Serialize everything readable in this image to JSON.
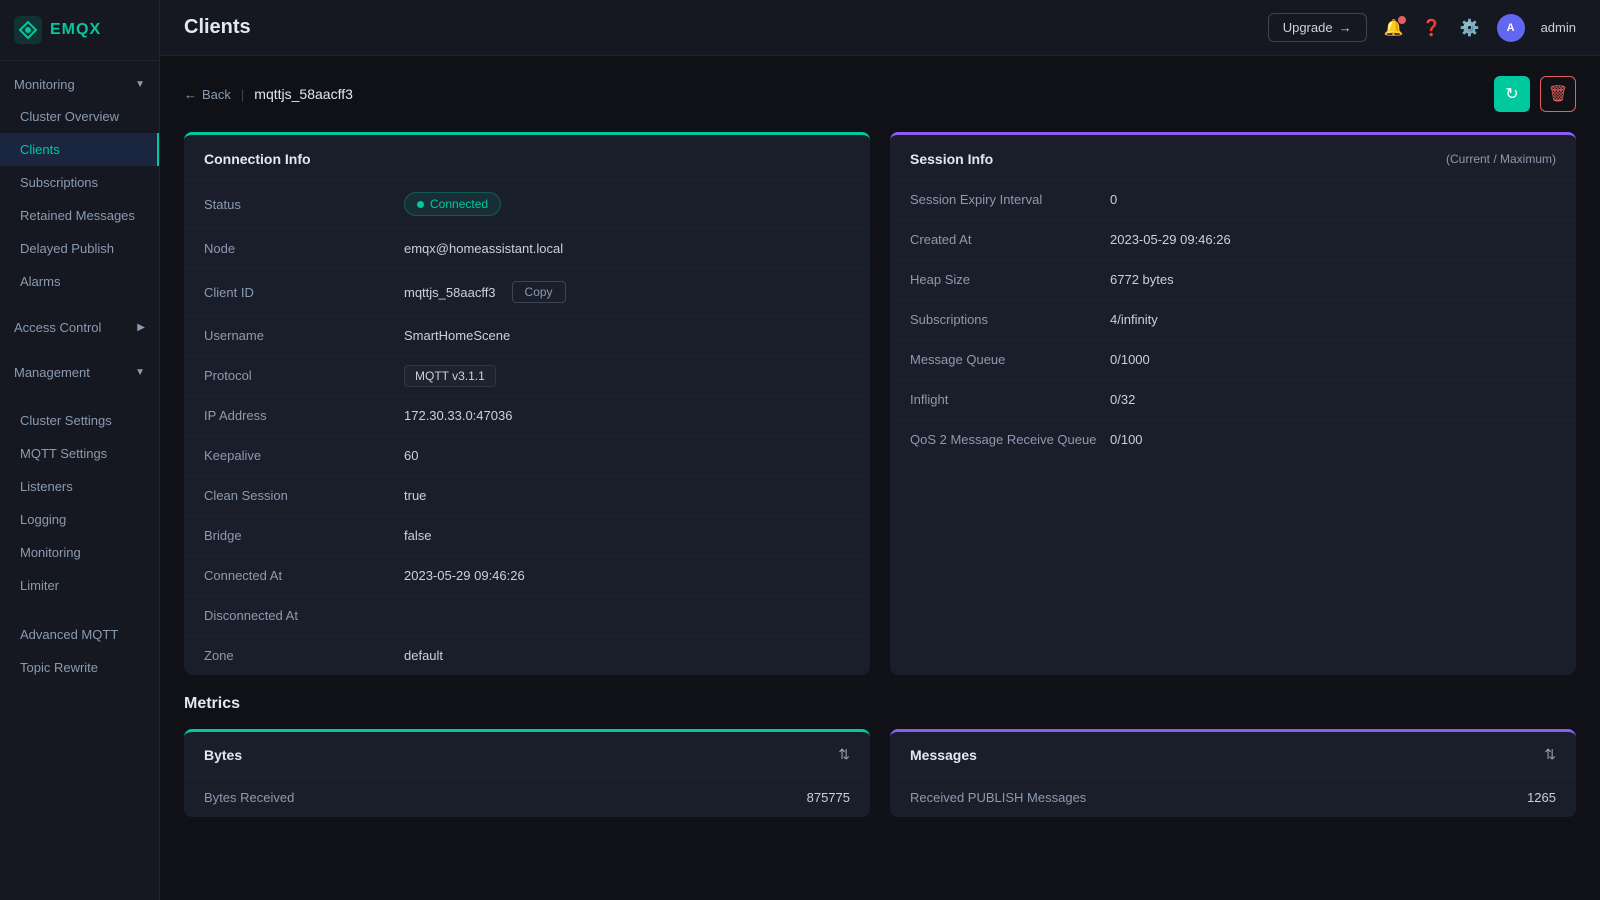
{
  "app": {
    "logo": "EMQX",
    "page_title": "Clients"
  },
  "topbar": {
    "upgrade_label": "Upgrade",
    "admin_label": "admin",
    "avatar_initials": "A"
  },
  "sidebar": {
    "monitoring_label": "Monitoring",
    "cluster_overview_label": "Cluster Overview",
    "clients_label": "Clients",
    "subscriptions_label": "Subscriptions",
    "retained_messages_label": "Retained Messages",
    "delayed_publish_label": "Delayed Publish",
    "alarms_label": "Alarms",
    "access_control_label": "Access Control",
    "management_label": "Management",
    "cluster_settings_label": "Cluster Settings",
    "mqtt_settings_label": "MQTT Settings",
    "listeners_label": "Listeners",
    "logging_label": "Logging",
    "monitoring_sub_label": "Monitoring",
    "limiter_label": "Limiter",
    "advanced_mqtt_label": "Advanced MQTT",
    "topic_rewrite_label": "Topic Rewrite"
  },
  "breadcrumb": {
    "back_label": "Back",
    "client_id": "mqttjs_58aacff3"
  },
  "connection_info": {
    "title": "Connection Info",
    "status_label": "Status",
    "status_value": "Connected",
    "node_label": "Node",
    "node_value": "emqx@homeassistant.local",
    "client_id_label": "Client ID",
    "client_id_value": "mqttjs_58aacff3",
    "copy_label": "Copy",
    "username_label": "Username",
    "username_value": "SmartHomeScene",
    "protocol_label": "Protocol",
    "protocol_value": "MQTT v3.1.1",
    "ip_address_label": "IP Address",
    "ip_address_value": "172.30.33.0:47036",
    "keepalive_label": "Keepalive",
    "keepalive_value": "60",
    "clean_session_label": "Clean Session",
    "clean_session_value": "true",
    "bridge_label": "Bridge",
    "bridge_value": "false",
    "connected_at_label": "Connected At",
    "connected_at_value": "2023-05-29 09:46:26",
    "disconnected_at_label": "Disconnected At",
    "disconnected_at_value": "",
    "zone_label": "Zone",
    "zone_value": "default"
  },
  "session_info": {
    "title": "Session Info",
    "subtitle": "(Current / Maximum)",
    "session_expiry_label": "Session Expiry Interval",
    "session_expiry_value": "0",
    "created_at_label": "Created At",
    "created_at_value": "2023-05-29 09:46:26",
    "heap_size_label": "Heap Size",
    "heap_size_value": "6772 bytes",
    "subscriptions_label": "Subscriptions",
    "subscriptions_value": "4/infinity",
    "message_queue_label": "Message Queue",
    "message_queue_value": "0/1000",
    "inflight_label": "Inflight",
    "inflight_value": "0/32",
    "qos2_label": "QoS 2 Message Receive Queue",
    "qos2_value": "0/100"
  },
  "metrics": {
    "title": "Metrics",
    "bytes_card": {
      "title": "Bytes",
      "bytes_received_label": "Bytes Received",
      "bytes_received_value": "875775"
    },
    "messages_card": {
      "title": "Messages",
      "received_publish_label": "Received PUBLISH Messages",
      "received_publish_value": "1265"
    }
  }
}
